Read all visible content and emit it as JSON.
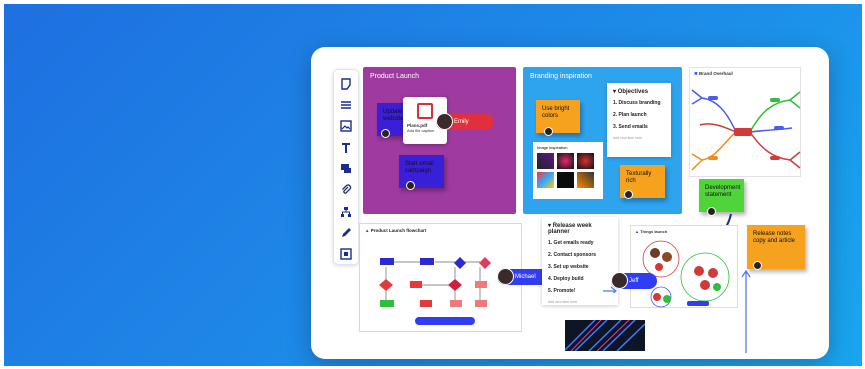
{
  "board": {
    "panels": {
      "product_launch": "Product Launch",
      "branding": "Branding inspiration",
      "brand_overhaul": "Brand Overhaul",
      "flowchart": "Product Launch flowchart",
      "image_inspiration": "Image inspiration",
      "diagram": "Things launch"
    },
    "notes": {
      "update_website": "Update website",
      "start_email": "Start email campaign",
      "bright_colors": "Use bright colors",
      "texturally_rich": "Texturally rich",
      "dev_statement": "Development statement",
      "release_notes": "Release notes copy and article"
    },
    "file_card": {
      "name": "Plans.pdf",
      "meta": "Add file caption"
    },
    "tags": {
      "emily": "Emily",
      "michael": "Michael",
      "jeff": "Jeff"
    },
    "objectives": {
      "title": "Objectives",
      "items": [
        "1.  Discuss branding",
        "2.  Plan launch",
        "3.  Send emails"
      ],
      "footer": "Add new item here"
    },
    "release": {
      "title": "Release week planner",
      "items": [
        "1.  Get emails ready",
        "2.  Contact sponsors",
        "3.  Set up website",
        "4.  Deploy build",
        "5.  Promote!"
      ],
      "footer": "Add new item here"
    }
  },
  "colors": {
    "background": "#1d8be8",
    "purple_panel": "#9e3aa0",
    "blue_panel": "#2ea3ee",
    "indigo_note": "#3a1fd8",
    "orange_note": "#f6a21f",
    "green_note": "#4fd43a",
    "tag_red": "#e12f3c",
    "tag_blue": "#2f3ef5"
  },
  "toolbar": {
    "icons": [
      "sticky-note-icon",
      "list-icon",
      "image-icon",
      "text-icon",
      "comment-icon",
      "attachment-icon",
      "hierarchy-icon",
      "pen-icon",
      "frame-icon"
    ]
  }
}
